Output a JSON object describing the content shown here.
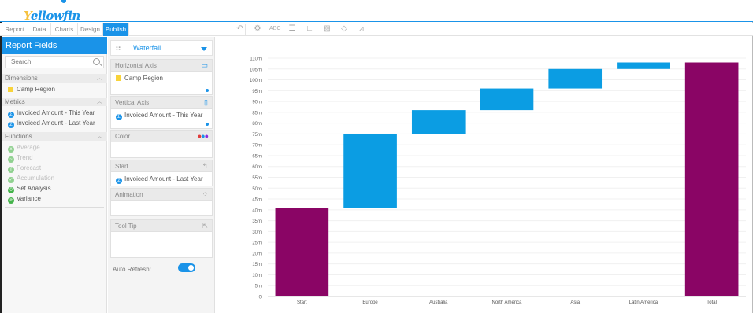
{
  "app": {
    "logo_prefix": "Y",
    "logo_rest": "ellowfin"
  },
  "tabs": [
    "Report",
    "Data",
    "Charts",
    "Design",
    "Publish"
  ],
  "toolbar_icons": [
    "undo-icon",
    "settings-icon",
    "text-icon",
    "list-icon",
    "axes-icon",
    "image-icon",
    "paint-icon",
    "line-chart-icon"
  ],
  "left_panel": {
    "title": "Report Fields",
    "search_placeholder": "Search",
    "dimensions_label": "Dimensions",
    "dimensions": [
      "Camp Region"
    ],
    "metrics_label": "Metrics",
    "metrics": [
      "Invoiced Amount - This Year",
      "Invoiced Amount - Last Year"
    ],
    "functions_label": "Functions",
    "functions": [
      {
        "label": "Average",
        "enabled": false
      },
      {
        "label": "Trend",
        "enabled": false
      },
      {
        "label": "Forecast",
        "enabled": false
      },
      {
        "label": "Accumulation",
        "enabled": false
      },
      {
        "label": "Set Analysis",
        "enabled": true
      },
      {
        "label": "Variance",
        "enabled": true
      }
    ]
  },
  "mid_panel": {
    "chart_type": "Waterfall",
    "horizontal_axis_label": "Horizontal Axis",
    "horizontal_axis_field": "Camp Region",
    "vertical_axis_label": "Vertical Axis",
    "vertical_axis_field": "Invoiced Amount - This Year",
    "color_label": "Color",
    "start_label": "Start",
    "start_field": "Invoiced Amount - Last Year",
    "animation_label": "Animation",
    "tooltip_label": "Tool Tip",
    "auto_refresh_label": "Auto Refresh:",
    "auto_refresh_on": true
  },
  "colors": {
    "accent": "#1a93e8",
    "total_bar": "#8a0565",
    "step_bar": "#0b9de3"
  },
  "chart_data": {
    "type": "bar",
    "subtype": "waterfall",
    "categories": [
      "Start",
      "Europe",
      "Australia",
      "North America",
      "Asia",
      "Latin America",
      "Total"
    ],
    "bars": [
      {
        "low": 0,
        "high": 41,
        "kind": "total"
      },
      {
        "low": 41,
        "high": 75,
        "kind": "step"
      },
      {
        "low": 75,
        "high": 86,
        "kind": "step"
      },
      {
        "low": 86,
        "high": 96,
        "kind": "step"
      },
      {
        "low": 96,
        "high": 105,
        "kind": "step"
      },
      {
        "low": 105,
        "high": 108,
        "kind": "step"
      },
      {
        "low": 0,
        "high": 108,
        "kind": "total"
      }
    ],
    "ylim": [
      0,
      110
    ],
    "yticks": [
      "0",
      "5m",
      "10m",
      "15m",
      "20m",
      "25m",
      "30m",
      "35m",
      "40m",
      "45m",
      "50m",
      "55m",
      "60m",
      "65m",
      "70m",
      "75m",
      "80m",
      "85m",
      "90m",
      "95m",
      "100m",
      "105m",
      "110m"
    ],
    "grid": true
  }
}
